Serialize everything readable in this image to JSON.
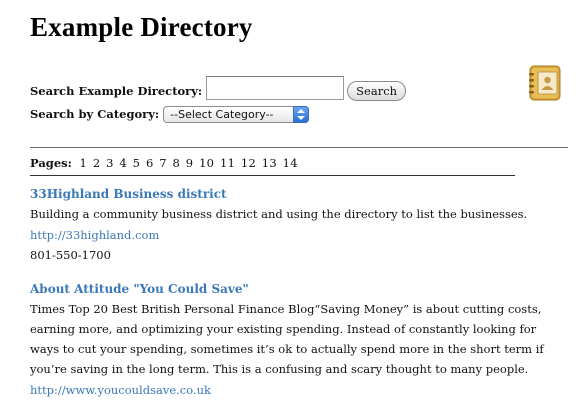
{
  "page": {
    "title": "Example Directory"
  },
  "search": {
    "label": "Search Example Directory:",
    "input_value": "",
    "button_label": "Search",
    "category_label": "Search by Category:",
    "category_selected": "--Select Category--"
  },
  "pagination": {
    "label": "Pages:",
    "pages": [
      "1",
      "2",
      "3",
      "4",
      "5",
      "6",
      "7",
      "8",
      "9",
      "10",
      "11",
      "12",
      "13",
      "14"
    ]
  },
  "listings": [
    {
      "title": "33Highland Business district",
      "description": "Building a community business district and using the directory to list the businesses.",
      "url": "http://33highland.com",
      "phone": "801-550-1700"
    },
    {
      "title": "About Attitude \"You Could Save\"",
      "description": "Times Top 20 Best British Personal Finance Blog“Saving Money” is about cutting costs, earning more, and optimizing your existing spending. Instead of constantly looking for ways to cut your spending, sometimes it’s ok to actually spend more in the short term if you’re saving in the long term. This is a confusing and scary thought to many people.",
      "url": "http://www.youcouldsave.co.uk",
      "phone": ""
    }
  ],
  "icons": {
    "address_book": "address-book-icon",
    "select_arrows": "updown-arrows-icon"
  },
  "colors": {
    "link": "#3a78b8",
    "select_accent": "#2c6fd6",
    "icon_gold": "#d9a93a"
  }
}
